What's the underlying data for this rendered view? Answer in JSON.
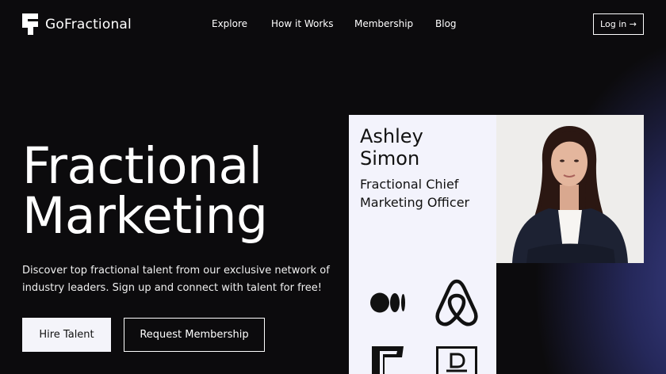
{
  "brand": {
    "name": "GoFractional",
    "icon": "gofractional-logo-icon"
  },
  "nav": {
    "links": [
      "Explore",
      "How it Works",
      "Membership",
      "Blog"
    ],
    "login_label": "Log in →"
  },
  "hero": {
    "title_line1": "Fractional",
    "title_line2": "Marketing",
    "description_line1": "Discover top fractional talent from our exclusive network of",
    "description_line2": "industry leaders. Sign up and connect with talent for free!",
    "primary_button": "Hire Talent",
    "secondary_button": "Request Membership"
  },
  "profile": {
    "name_line1": "Ashley",
    "name_line2": "Simon",
    "role_line1": "Fractional Chief",
    "role_line2": "Marketing Officer",
    "company_logos": [
      "medium-logo-icon",
      "airbnb-logo-icon",
      "foursquare-logo-icon",
      "doordash-d-logo-icon"
    ]
  },
  "colors": {
    "background": "#0c0b0d",
    "card": "#f3f3fc",
    "button_light": "#f4f4fa",
    "glow": "#3a3f86"
  }
}
